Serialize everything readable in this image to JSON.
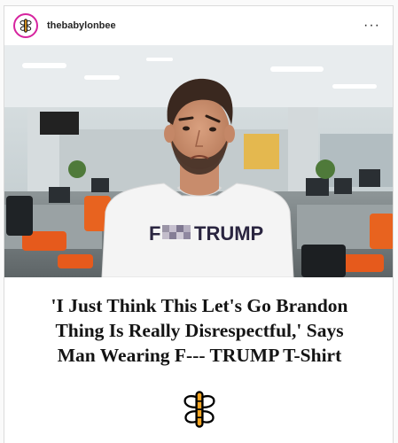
{
  "post": {
    "username": "thebabylonbee",
    "more_label": "···",
    "shirt_text_prefix": "F",
    "shirt_text_main": "TRUMP",
    "headline_lines": [
      "'I Just Think This Let's Go Brandon",
      "Thing Is Really Disrespectful,' Says",
      "Man Wearing F--- TRUMP T-Shirt"
    ]
  },
  "icons": {
    "avatar": "bee-logo-icon",
    "more": "more-options-icon",
    "brand": "bee-logo-icon"
  },
  "colors": {
    "bee_orange": "#f5a623",
    "text_dark": "#141414",
    "ring": "#d6249f"
  }
}
